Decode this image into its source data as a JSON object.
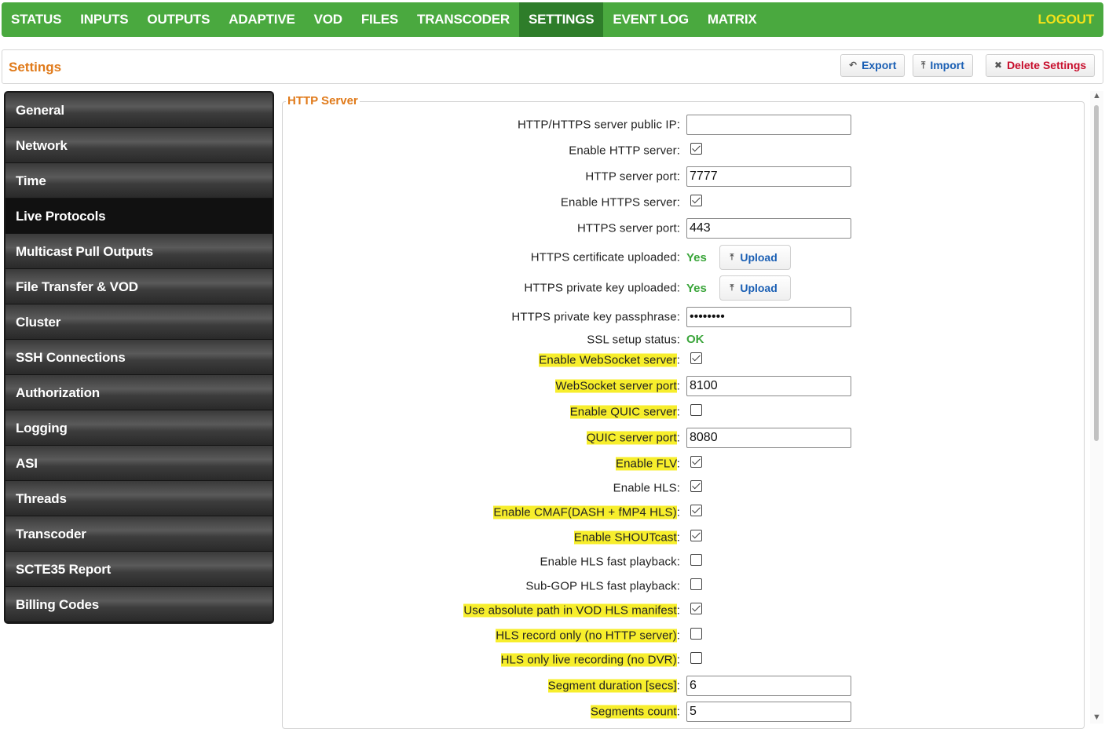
{
  "nav": {
    "items": [
      "STATUS",
      "INPUTS",
      "OUTPUTS",
      "ADAPTIVE",
      "VOD",
      "FILES",
      "TRANSCODER",
      "SETTINGS",
      "EVENT LOG",
      "MATRIX"
    ],
    "active": "SETTINGS",
    "logout": "LOGOUT"
  },
  "header": {
    "title": "Settings",
    "export_label": "Export",
    "import_label": "Import",
    "delete_label": "Delete Settings"
  },
  "sidebar": {
    "active": "Live Protocols",
    "items": [
      "General",
      "Network",
      "Time",
      "Live Protocols",
      "Multicast Pull Outputs",
      "File Transfer & VOD",
      "Cluster",
      "SSH Connections",
      "Authorization",
      "Logging",
      "ASI",
      "Threads",
      "Transcoder",
      "SCTE35 Report",
      "Billing Codes"
    ]
  },
  "section": {
    "legend": "HTTP Server"
  },
  "fields": {
    "public_ip": {
      "label": "HTTP/HTTPS server public IP",
      "value": ""
    },
    "enable_http": {
      "label": "Enable HTTP server",
      "checked": true
    },
    "http_port": {
      "label": "HTTP server port",
      "value": "7777"
    },
    "enable_https": {
      "label": "Enable HTTPS server",
      "checked": true
    },
    "https_port": {
      "label": "HTTPS server port",
      "value": "443"
    },
    "https_cert": {
      "label": "HTTPS certificate uploaded",
      "status": "Yes",
      "button": "Upload"
    },
    "https_key": {
      "label": "HTTPS private key uploaded",
      "status": "Yes",
      "button": "Upload"
    },
    "https_passphrase": {
      "label": "HTTPS private key passphrase",
      "value": "••••••••"
    },
    "ssl_status": {
      "label": "SSL setup status",
      "status": "OK"
    },
    "enable_websocket": {
      "label": "Enable WebSocket server",
      "checked": true
    },
    "websocket_port": {
      "label": "WebSocket server port",
      "value": "8100"
    },
    "enable_quic": {
      "label": "Enable QUIC server",
      "checked": false
    },
    "quic_port": {
      "label": "QUIC server port",
      "value": "8080"
    },
    "enable_flv": {
      "label": "Enable FLV",
      "checked": true
    },
    "enable_hls": {
      "label": "Enable HLS",
      "checked": true
    },
    "enable_cmaf": {
      "label": "Enable CMAF(DASH + fMP4 HLS)",
      "checked": true
    },
    "enable_shoutcast": {
      "label": "Enable SHOUTcast",
      "checked": true
    },
    "hls_fast": {
      "label": "Enable HLS fast playback",
      "checked": false
    },
    "subgop_hls": {
      "label": "Sub-GOP HLS fast playback",
      "checked": false
    },
    "abs_path": {
      "label": "Use absolute path in VOD HLS manifest",
      "checked": true
    },
    "hls_record_only": {
      "label": "HLS record only (no HTTP server)",
      "checked": false
    },
    "hls_live_only": {
      "label": "HLS only live recording (no DVR)",
      "checked": false
    },
    "segment_duration": {
      "label": "Segment duration [secs]",
      "value": "6"
    },
    "segments_count": {
      "label": "Segments count",
      "value": "5"
    }
  },
  "colors": {
    "nav_bg": "#4aa93f",
    "nav_active": "#2e7d2a",
    "logout": "#f3e21a",
    "accent_orange": "#e07a1a",
    "ok_green": "#3aa53a",
    "link_blue": "#1a5fb4",
    "danger_red": "#c8102e",
    "highlight": "#f7ee2c"
  }
}
